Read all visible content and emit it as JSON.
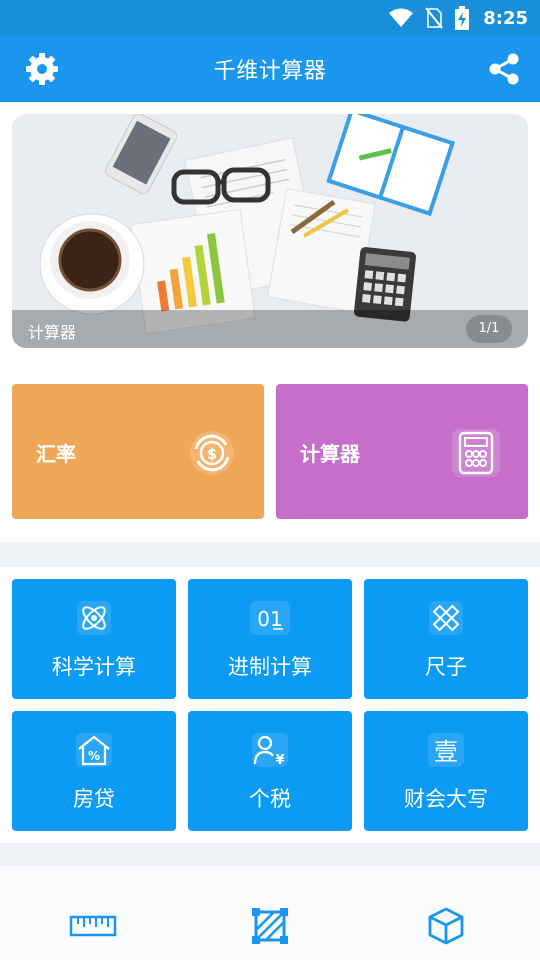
{
  "status_bar": {
    "time": "8:25",
    "icons": [
      "wifi-icon",
      "no-sim-icon",
      "battery-charging-icon"
    ]
  },
  "app_bar": {
    "title": "千维计算器",
    "left_icon": "gear-icon",
    "right_icon": "share-icon"
  },
  "banner": {
    "caption": "计算器",
    "page_indicator": "1/1"
  },
  "big_cards": [
    {
      "label": "汇率",
      "icon": "currency-exchange-icon",
      "color": "#f0a657"
    },
    {
      "label": "计算器",
      "icon": "calculator-icon",
      "color": "#c56fca"
    }
  ],
  "tiles": [
    {
      "label": "科学计算",
      "icon": "atom-icon"
    },
    {
      "label": "进制计算",
      "icon": "binary-icon",
      "icon_text": "01"
    },
    {
      "label": "尺子",
      "icon": "ruler-pencil-icon"
    },
    {
      "label": "房贷",
      "icon": "house-percent-icon"
    },
    {
      "label": "个税",
      "icon": "person-yen-icon"
    },
    {
      "label": "财会大写",
      "icon": "chinese-numeral-icon",
      "icon_text": "壹"
    }
  ],
  "bottom_nav": [
    {
      "icon": "ruler-icon"
    },
    {
      "icon": "crop-frame-icon"
    },
    {
      "icon": "cube-icon"
    }
  ],
  "colors": {
    "status_bar": "#1a8fd9",
    "app_bar": "#1b96ef",
    "tile": "#0b9bf5",
    "nav_icon": "#1b96ef"
  }
}
